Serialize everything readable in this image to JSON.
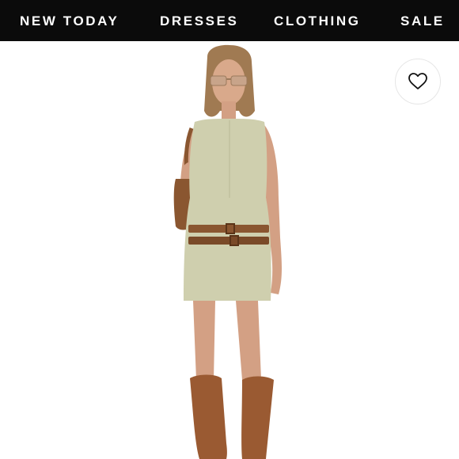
{
  "nav": {
    "items": [
      {
        "label": "NEW TODAY"
      },
      {
        "label": "DRESSES"
      },
      {
        "label": "CLOTHING"
      },
      {
        "label": "SALE"
      }
    ]
  },
  "product": {
    "wishlist_icon": "heart-outline-icon"
  },
  "colors": {
    "nav_background": "#0b0b0b",
    "nav_text": "#ffffff",
    "dress": "#cfcfae",
    "belt": "#8a5630",
    "boots": "#9a5a32"
  }
}
